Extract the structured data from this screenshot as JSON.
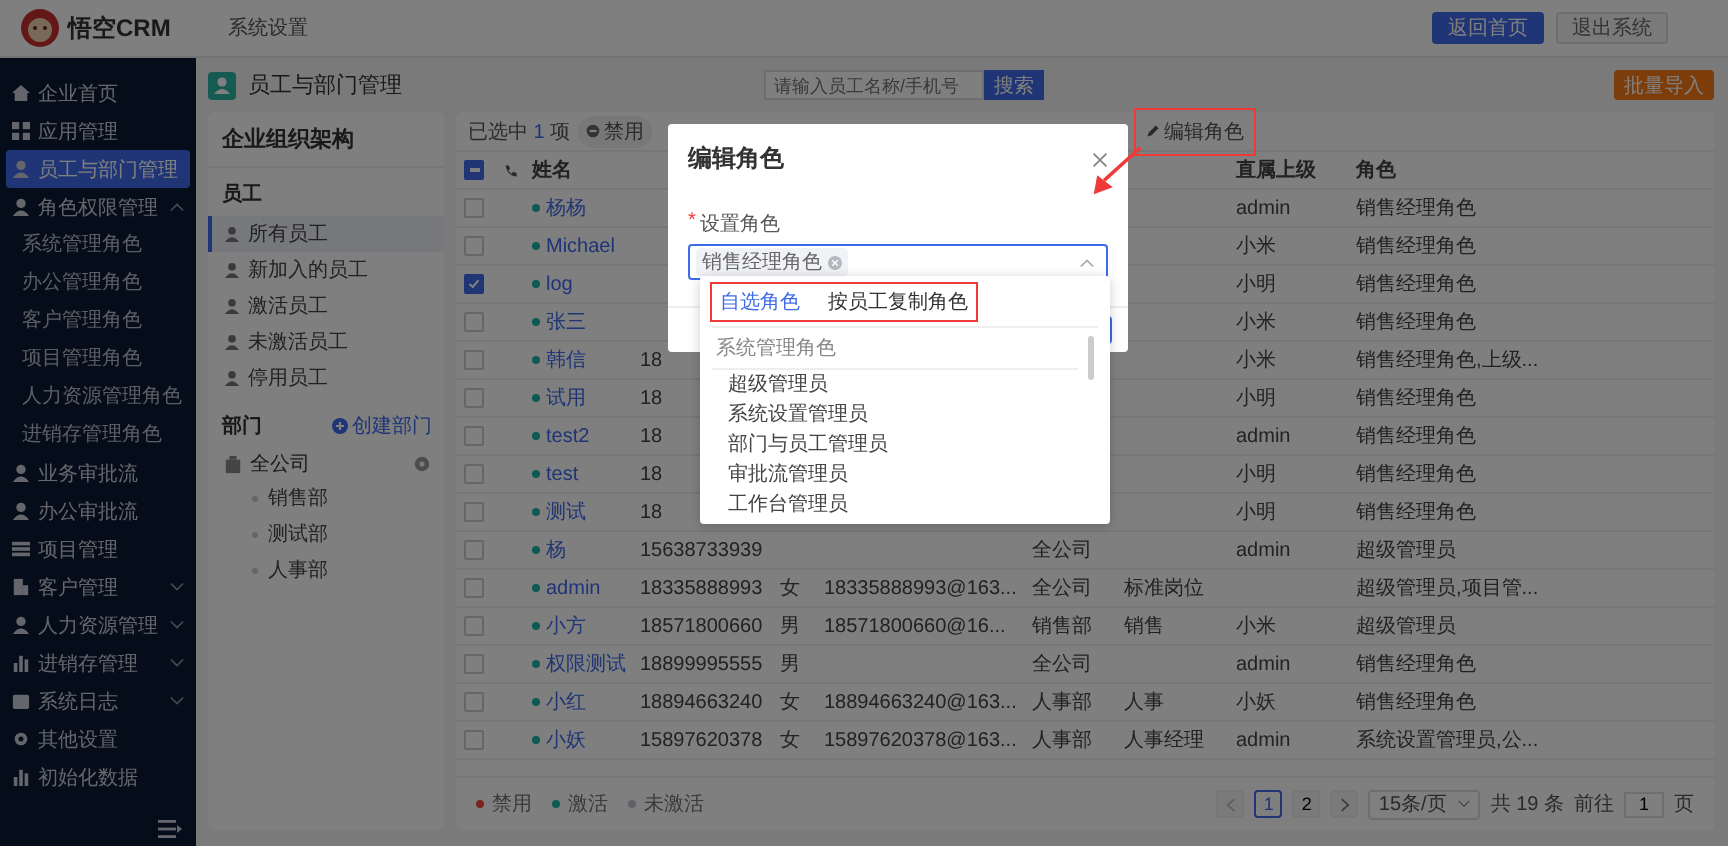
{
  "header": {
    "logo": "悟空CRM",
    "nav": "系统设置",
    "buttons": [
      {
        "label": "返回首页",
        "kind": "primary"
      },
      {
        "label": "退出系统",
        "kind": "plain"
      }
    ]
  },
  "sidebar": {
    "items": [
      {
        "label": "企业首页",
        "selected": false
      },
      {
        "label": "应用管理",
        "selected": false
      },
      {
        "label": "员工与部门管理",
        "selected": true
      },
      {
        "label": "角色权限管理",
        "selected": false,
        "expanded": true,
        "children": [
          {
            "label": "系统管理角色"
          },
          {
            "label": "办公管理角色"
          },
          {
            "label": "客户管理角色"
          },
          {
            "label": "项目管理角色"
          },
          {
            "label": "人力资源管理角色"
          },
          {
            "label": "进销存管理角色"
          }
        ]
      },
      {
        "label": "业务审批流",
        "selected": false
      },
      {
        "label": "办公审批流",
        "selected": false
      },
      {
        "label": "项目管理",
        "selected": false
      },
      {
        "label": "客户管理",
        "selected": false,
        "expanded": false
      },
      {
        "label": "人力资源管理",
        "selected": false,
        "expanded": false
      },
      {
        "label": "进销存管理",
        "selected": false,
        "expanded": false
      },
      {
        "label": "系统日志",
        "selected": false,
        "expanded": false
      },
      {
        "label": "其他设置",
        "selected": false
      },
      {
        "label": "初始化数据",
        "selected": false
      }
    ]
  },
  "page": {
    "title": "员工与部门管理",
    "search": {
      "placeholder": "请输入员工名称/手机号"
    },
    "search_button": "搜索",
    "import_button": "批量导入"
  },
  "org_panel": {
    "title": "企业组织架构",
    "staff_heading": "员工",
    "staff_items": [
      {
        "label": "所有员工",
        "selected": true
      },
      {
        "label": "新加入的员工",
        "selected": false
      },
      {
        "label": "激活员工",
        "selected": false
      },
      {
        "label": "未激活员工",
        "selected": false
      },
      {
        "label": "停用员工",
        "selected": false
      }
    ],
    "dept_heading": "部门",
    "create_link": "创建部门",
    "tree": [
      {
        "label": "全公司",
        "children": [
          {
            "label": "销售部"
          },
          {
            "label": "测试部"
          },
          {
            "label": "人事部"
          }
        ]
      }
    ]
  },
  "toolbar": {
    "selected_prefix": "已选中",
    "selected_count": "1",
    "selected_suffix": "项",
    "actions": [
      {
        "label": "禁用"
      },
      {
        "label": "编辑角色",
        "highlighted": true
      }
    ]
  },
  "table": {
    "columns": [
      "",
      "",
      "姓名",
      "",
      "",
      "",
      "",
      "",
      "直属上级",
      "角色"
    ],
    "select_all_indeterminate": true,
    "rows": [
      {
        "checked": false,
        "color": "#0f5a54",
        "name": "杨杨",
        "superior": "admin",
        "role": "销售经理角色"
      },
      {
        "checked": false,
        "color": "#0f5a54",
        "name": "Michael",
        "superior": "小米",
        "role": "销售经理角色"
      },
      {
        "checked": true,
        "color": "#0f5a54",
        "name": "log",
        "superior": "小明",
        "role": "销售经理角色"
      },
      {
        "checked": false,
        "color": "#0f5a54",
        "name": "张三",
        "superior": "小米",
        "role": "销售经理角色"
      },
      {
        "checked": false,
        "color": "#0f5a54",
        "name": "韩信",
        "phone": "18",
        "superior": "小米",
        "role": "销售经理角色,上级..."
      },
      {
        "checked": false,
        "color": "#0f5a54",
        "name": "试用",
        "phone": "18",
        "superior": "小明",
        "role": "销售经理角色"
      },
      {
        "checked": false,
        "color": "#0f5a54",
        "name": "test2",
        "phone": "18",
        "superior": "admin",
        "role": "销售经理角色"
      },
      {
        "checked": false,
        "color": "#0f5a54",
        "name": "test",
        "phone": "18",
        "superior": "小明",
        "role": "销售经理角色"
      },
      {
        "checked": false,
        "color": "#0f5a54",
        "name": "测试",
        "phone": "18",
        "superior": "小明",
        "role": "销售经理角色"
      },
      {
        "checked": false,
        "color": "#0f5a54",
        "name": "杨",
        "phone": "15638733939",
        "dept": "全公司",
        "superior": "admin",
        "role": "超级管理员"
      },
      {
        "checked": false,
        "color": "#0f5a54",
        "name": "admin",
        "phone": "18335888993",
        "gender": "女",
        "email": "18335888993@163...",
        "dept": "全公司",
        "post": "标准岗位",
        "role": "超级管理员,项目管..."
      },
      {
        "checked": false,
        "color": "#0f5a54",
        "name": "小方",
        "phone": "18571800660",
        "gender": "男",
        "email": "18571800660@16...",
        "dept": "销售部",
        "post": "销售",
        "superior": "小米",
        "role": "超级管理员"
      },
      {
        "checked": false,
        "color": "#0f5a54",
        "name": "权限测试",
        "phone": "18899995555",
        "gender": "男",
        "dept": "全公司",
        "superior": "admin",
        "role": "销售经理角色"
      },
      {
        "checked": false,
        "color": "#0f5a54",
        "name": "小红",
        "phone": "18894663240",
        "gender": "女",
        "email": "18894663240@163...",
        "dept": "人事部",
        "post": "人事",
        "superior": "小妖",
        "role": "销售经理角色"
      },
      {
        "checked": false,
        "color": "#0f5a54",
        "name": "小妖",
        "phone": "15897620378",
        "gender": "女",
        "email": "15897620378@163...",
        "dept": "人事部",
        "post": "人事经理",
        "superior": "admin",
        "role": "系统设置管理员,公..."
      }
    ]
  },
  "legend": [
    {
      "label": "禁用",
      "color": "#7a241e"
    },
    {
      "label": "激活",
      "color": "#0f5a54"
    },
    {
      "label": "未激活",
      "color": "#606266"
    }
  ],
  "pagination": {
    "pages": [
      {
        "label": "1",
        "selected": true
      },
      {
        "label": "2",
        "selected": false
      }
    ],
    "page_size": "15条/页",
    "total": "共 19 条",
    "goto_label": "前往",
    "goto_value": "1",
    "goto_suffix": "页"
  },
  "dialog": {
    "title": "编辑角色",
    "required_mark": "*",
    "field_label": "设置角色",
    "tags": [
      "销售经理角色"
    ]
  },
  "dropdown": {
    "tabs_highlighted": true,
    "tabs": [
      {
        "label": "自选角色",
        "selected": true
      },
      {
        "label": "按员工复制角色",
        "selected": false
      }
    ],
    "group": "系统管理角色",
    "options": [
      "超级管理员",
      "系统设置管理员",
      "部门与员工管理员",
      "审批流管理员",
      "工作台管理员"
    ]
  }
}
